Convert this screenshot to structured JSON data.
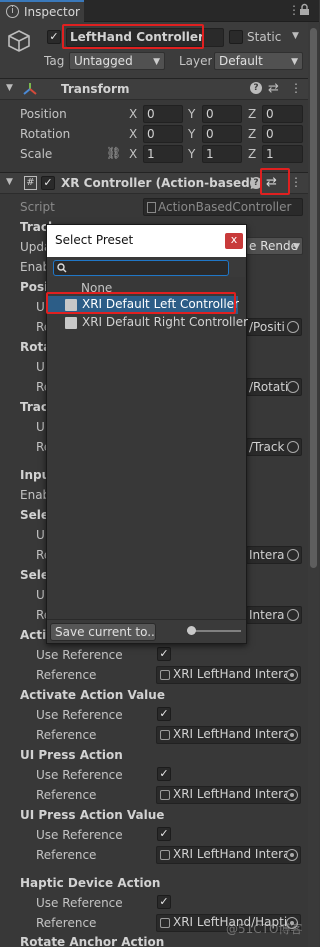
{
  "tab": {
    "title": "Inspector"
  },
  "object": {
    "name": "LeftHand Controller",
    "static_label": "Static",
    "tag_label": "Tag",
    "tag_value": "Untagged",
    "layer_label": "Layer",
    "layer_value": "Default"
  },
  "transform": {
    "title": "Transform",
    "rows": [
      {
        "label": "Position",
        "x": "0",
        "y": "0",
        "z": "0"
      },
      {
        "label": "Rotation",
        "x": "0",
        "y": "0",
        "z": "0"
      },
      {
        "label": "Scale",
        "x": "1",
        "y": "1",
        "z": "1"
      }
    ],
    "axis": {
      "x": "X",
      "y": "Y",
      "z": "Z"
    }
  },
  "xr": {
    "title": "XR Controller (Action-based)",
    "script_label": "Script",
    "script_value": "ActionBasedController",
    "peek": [
      {
        "text": "Track"
      },
      {
        "text": "Upda"
      },
      {
        "text": "Enab"
      },
      {
        "text": "Posi"
      },
      {
        "text": "U"
      },
      {
        "text": "Re"
      },
      {
        "text": "Rota"
      },
      {
        "text": "U"
      },
      {
        "text": "Re"
      },
      {
        "text": "Trac"
      },
      {
        "text": "U"
      },
      {
        "text": "Re"
      },
      {
        "text": "Inpu"
      },
      {
        "text": "Enab"
      },
      {
        "text": "Sele"
      },
      {
        "text": "U"
      },
      {
        "text": "Re"
      },
      {
        "text": "Sele"
      },
      {
        "text": "U"
      },
      {
        "text": "Re"
      },
      {
        "text": "Acti"
      }
    ],
    "right_fields": {
      "update_drop": "e Rende",
      "pos_ref": "/Positi",
      "rot_ref": "/Rotati",
      "track_ref": "/Track",
      "select_ref": "Intera",
      "select_value_ref": "Intera"
    },
    "sections": [
      {
        "title": "Activate Action Value",
        "use_ref": "Use Reference",
        "ref": "Reference",
        "value": "XRI LeftHand Intera"
      },
      {
        "title": "UI Press Action",
        "use_ref": "Use Reference",
        "ref": "Reference",
        "value": "XRI LeftHand Intera"
      },
      {
        "title": "UI Press Action Value",
        "use_ref": "Use Reference",
        "ref": "Reference",
        "value": "XRI LeftHand Intera"
      },
      {
        "title": "Haptic Device Action",
        "use_ref": "Use Reference",
        "ref": "Reference",
        "value": "XRI LeftHand/Haptic"
      }
    ],
    "activate": {
      "use_ref": "Use Reference",
      "ref": "Reference",
      "value": "XRI LeftHand Intera"
    },
    "last_title": "Rotate Anchor Action"
  },
  "popup": {
    "title": "Select Preset",
    "close": "x",
    "search_placeholder": "",
    "items": [
      {
        "label": "None"
      },
      {
        "label": "XRI Default Left Controller"
      },
      {
        "label": "XRI Default Right Controller"
      }
    ],
    "save_label": "Save current to..."
  },
  "watermark": "@51CTO博客"
}
